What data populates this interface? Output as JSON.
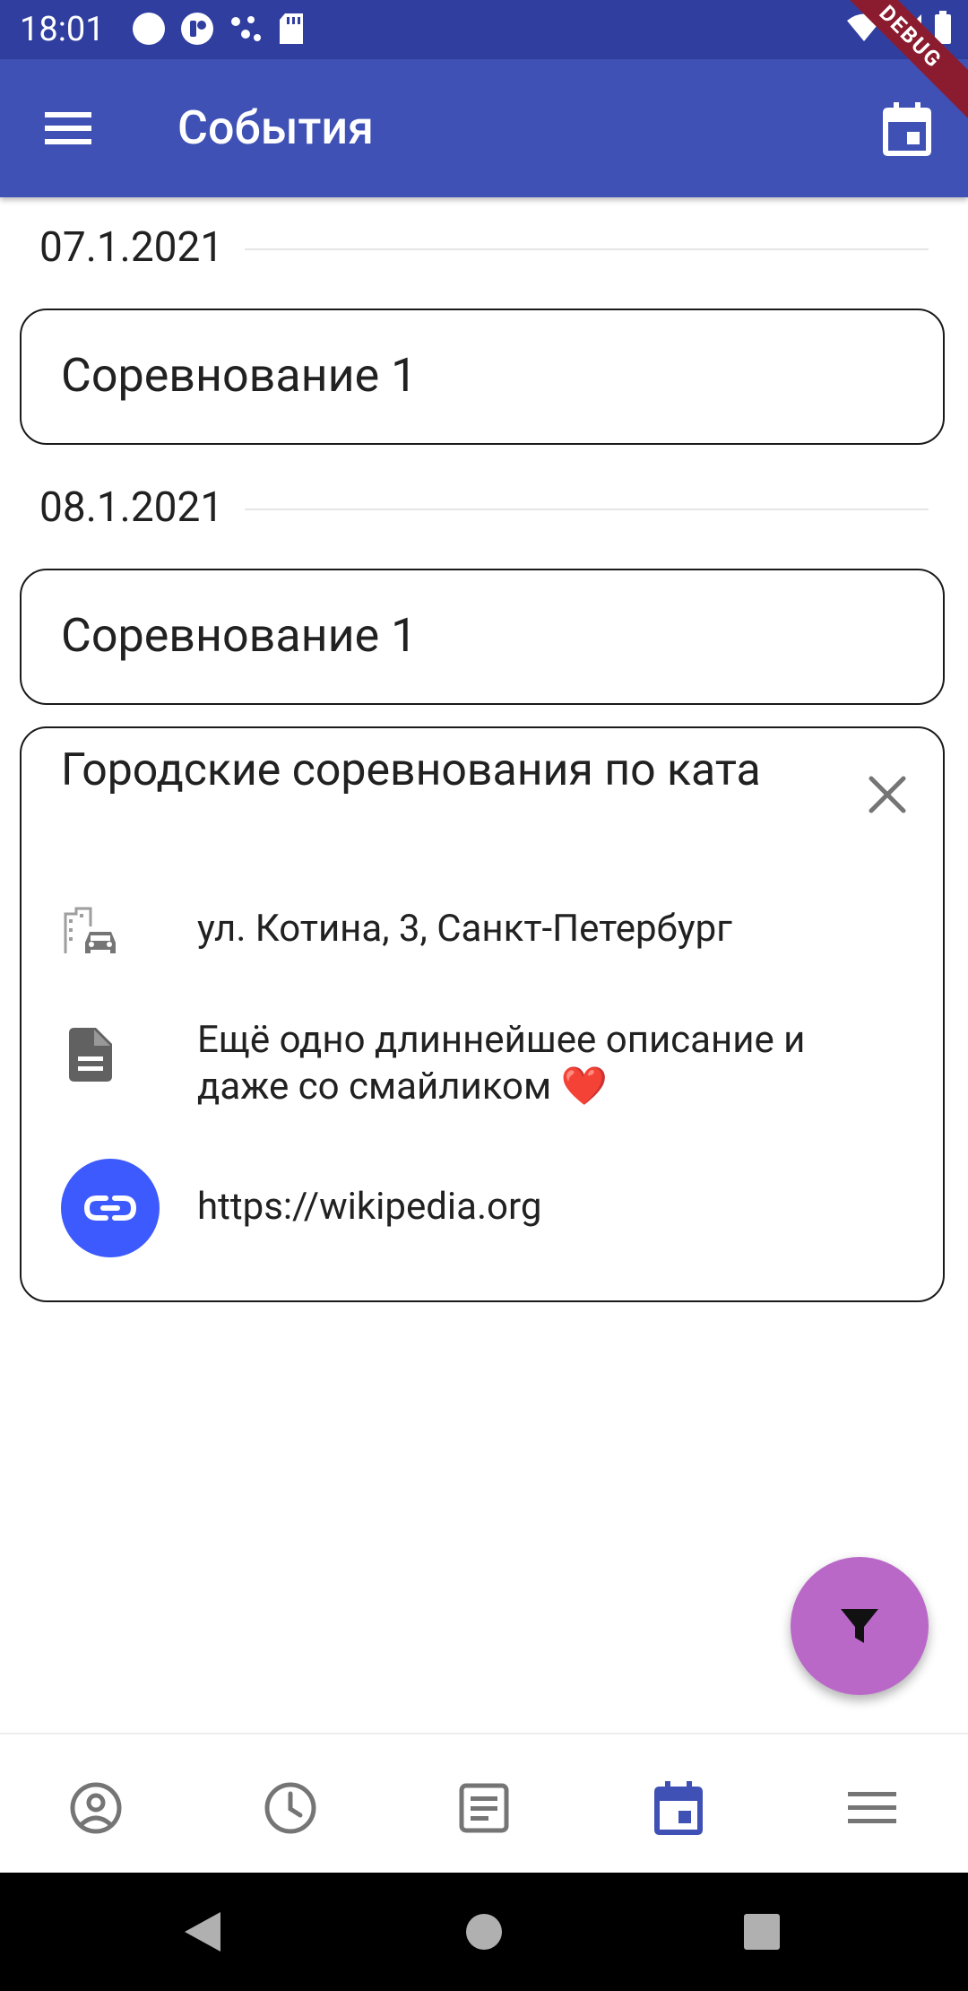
{
  "status_bar": {
    "time": "18:01"
  },
  "app_bar": {
    "title": "События",
    "debug_label": "DEBUG"
  },
  "groups": [
    {
      "date": "07.1.2021",
      "events": [
        {
          "title": "Соревнование 1"
        }
      ]
    },
    {
      "date": "08.1.2021",
      "events": [
        {
          "title": "Соревнование 1"
        }
      ]
    }
  ],
  "expanded_event": {
    "title": "Городские соревнования по ката",
    "address": "ул. Котина, 3, Санкт-Петербург",
    "description": "Ещё одно длиннейшее описание и даже со смайликом ❤️",
    "link": "https://wikipedia.org"
  },
  "bottom_nav": {
    "items": [
      {
        "icon": "account-circle-icon",
        "active": false
      },
      {
        "icon": "clock-icon",
        "active": false
      },
      {
        "icon": "article-icon",
        "active": false
      },
      {
        "icon": "calendar-icon",
        "active": true
      },
      {
        "icon": "menu-icon",
        "active": false
      }
    ]
  },
  "colors": {
    "status_bar": "#303f9f",
    "app_bar": "#3f51b5",
    "fab": "#ba68c8",
    "link_button": "#3d5afe",
    "nav_active": "#3f51b5",
    "nav_inactive": "#757575",
    "debug_banner": "#8b1b2f"
  }
}
